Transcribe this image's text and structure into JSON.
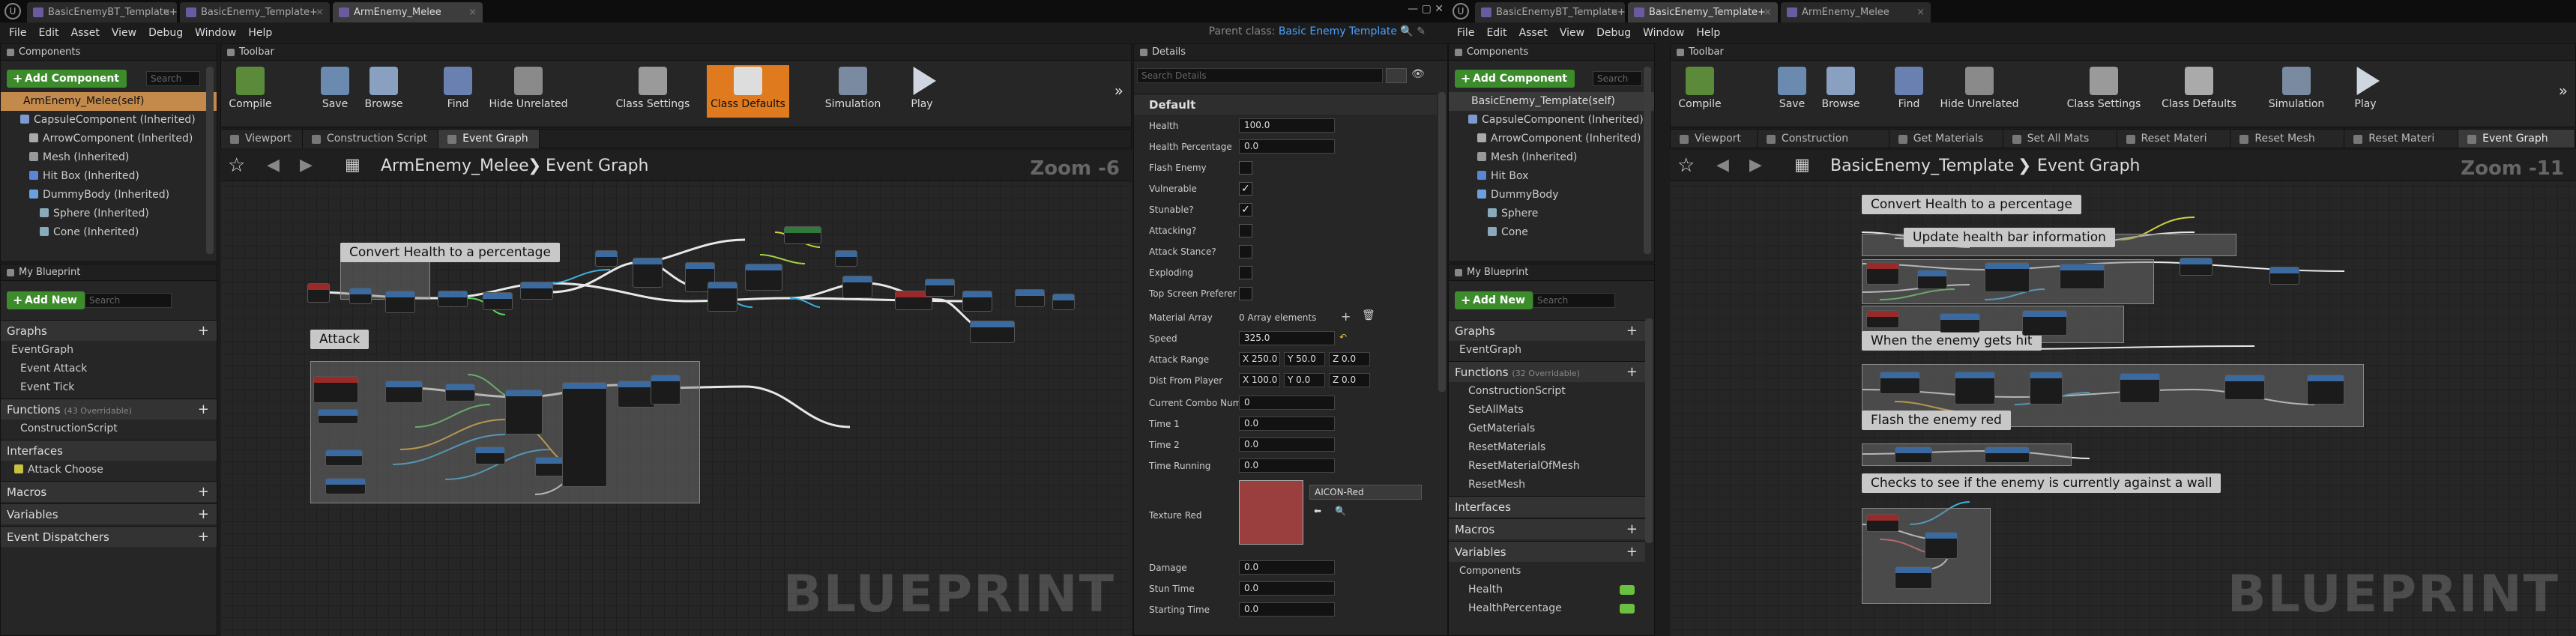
{
  "colors": {
    "accent_orange": "#e07a1e",
    "add_green": "#3c8c2b",
    "link_blue": "#4aa3ff",
    "node_blue": "#3a6aa0",
    "node_red": "#9a2a2a",
    "swatch_red": "#9b3e3e"
  },
  "w1": {
    "tabs": [
      "BasicEnemyBT_Template+",
      "BasicEnemy_Template+",
      "ArmEnemy_Melee"
    ],
    "parent_label": "Parent class:",
    "parent_value": "Basic Enemy Template",
    "menus": [
      "File",
      "Edit",
      "Asset",
      "View",
      "Debug",
      "Window",
      "Help"
    ],
    "components": {
      "title": "Components",
      "add": "Add Component",
      "search": "Search",
      "items": [
        "ArmEnemy_Melee(self)",
        "CapsuleComponent (Inherited)",
        "ArrowComponent (Inherited)",
        "Mesh (Inherited)",
        "Hit Box (Inherited)",
        "DummyBody (Inherited)",
        "Sphere (Inherited)",
        "Cone (Inherited)"
      ]
    },
    "myblueprint": {
      "title": "My Blueprint",
      "add": "Add New",
      "search": "Search",
      "graphs": "Graphs",
      "graph_items": [
        "EventGraph",
        "Event Attack",
        "Event Tick"
      ],
      "functions": "Functions",
      "functions_sub": "(43 Overridable)",
      "function_items": [
        "ConstructionScript"
      ],
      "interfaces": "Interfaces",
      "interface_items": [
        "Attack Choose"
      ],
      "macros": "Macros",
      "variables": "Variables",
      "dispatchers": "Event Dispatchers"
    },
    "toolbar": {
      "title": "Toolbar",
      "buttons": [
        "Compile",
        "Save",
        "Browse",
        "Find",
        "Hide Unrelated",
        "Class Settings",
        "Class Defaults",
        "Simulation",
        "Play"
      ]
    },
    "subtabs": [
      "Viewport",
      "Construction Script",
      "Event Graph"
    ],
    "graph": {
      "crumb1": "ArmEnemy_Melee",
      "crumb2": "Event Graph",
      "zoom": "Zoom -6",
      "watermark": "BLUEPRINT",
      "comments": [
        "Convert Health to a percentage",
        "Attack"
      ]
    },
    "details": {
      "title": "Details",
      "search": "Search Details",
      "section": "Default",
      "rows": [
        {
          "l": "Health",
          "v": "100.0"
        },
        {
          "l": "Health Percentage",
          "v": "0.0"
        },
        {
          "l": "Flash Enemy",
          "c": ""
        },
        {
          "l": "Vulnerable",
          "c": "✓"
        },
        {
          "l": "Stunable?",
          "c": "✓"
        },
        {
          "l": "Attacking?",
          "c": ""
        },
        {
          "l": "Attack Stance?",
          "c": ""
        },
        {
          "l": "Exploding",
          "c": ""
        },
        {
          "l": "Top Screen Preferer",
          "c": ""
        }
      ],
      "material_array": "Material Array",
      "material_value": "0 Array elements",
      "speed_l": "Speed",
      "speed_v": "325.0",
      "attack_range_l": "Attack Range",
      "attack_range": [
        "X 250.0",
        "Y 50.0",
        "Z 0.0"
      ],
      "dist_player_l": "Dist From Player",
      "dist_player": [
        "X 100.0",
        "Y 0.0",
        "Z 0.0"
      ],
      "rows2": [
        {
          "l": "Current Combo Num",
          "v": "0"
        },
        {
          "l": "Time 1",
          "v": "0.0"
        },
        {
          "l": "Time 2",
          "v": "0.0"
        },
        {
          "l": "Time Running",
          "v": "0.0"
        }
      ],
      "texture_l": "Texture Red",
      "texture_v": "AICON-Red",
      "rows3": [
        {
          "l": "Damage",
          "v": "0.0"
        },
        {
          "l": "Stun Time",
          "v": "0.0"
        },
        {
          "l": "Starting Time",
          "v": "0.0"
        }
      ]
    }
  },
  "w2": {
    "tabs": [
      "BasicEnemyBT_Template+",
      "BasicEnemy_Template+",
      "ArmEnemy_Melee"
    ],
    "menus": [
      "File",
      "Edit",
      "Asset",
      "View",
      "Debug",
      "Window",
      "Help"
    ],
    "components": {
      "title": "Components",
      "add": "Add Component",
      "search": "Search",
      "items": [
        "BasicEnemy_Template(self)",
        "CapsuleComponent (Inherited)",
        "ArrowComponent (Inherited)",
        "Mesh (Inherited)",
        "Hit Box",
        "DummyBody",
        "Sphere",
        "Cone"
      ]
    },
    "myblueprint": {
      "title": "My Blueprint",
      "add": "Add New",
      "search": "Search",
      "graphs": "Graphs",
      "graph_items": [
        "EventGraph"
      ],
      "functions": "Functions",
      "functions_sub": "(32 Overridable)",
      "function_items": [
        "ConstructionScript",
        "SetAllMats",
        "GetMaterials",
        "ResetMaterials",
        "ResetMaterialOfMesh",
        "ResetMesh"
      ],
      "interfaces": "Interfaces",
      "macros": "Macros",
      "variables": "Variables",
      "components": "Components",
      "var_items": [
        "Health",
        "HealthPercentage"
      ]
    },
    "toolbar": {
      "title": "Toolbar",
      "buttons": [
        "Compile",
        "Save",
        "Browse",
        "Find",
        "Hide Unrelated",
        "Class Settings",
        "Class Defaults",
        "Simulation",
        "Play"
      ]
    },
    "subtabs": [
      "Viewport",
      "Construction",
      "Get Materials",
      "Set All Mats",
      "Reset Materi",
      "Reset Mesh",
      "Reset Materi",
      "Event Graph"
    ],
    "graph": {
      "crumb1": "BasicEnemy_Template",
      "crumb2": "Event Graph",
      "zoom": "Zoom -11",
      "watermark": "BLUEPRINT",
      "comments": [
        "Convert Health to a percentage",
        "Update health bar information",
        "When the enemy gets hit",
        "Flash the enemy red",
        "Checks to see if the enemy is currently against a wall"
      ]
    }
  }
}
